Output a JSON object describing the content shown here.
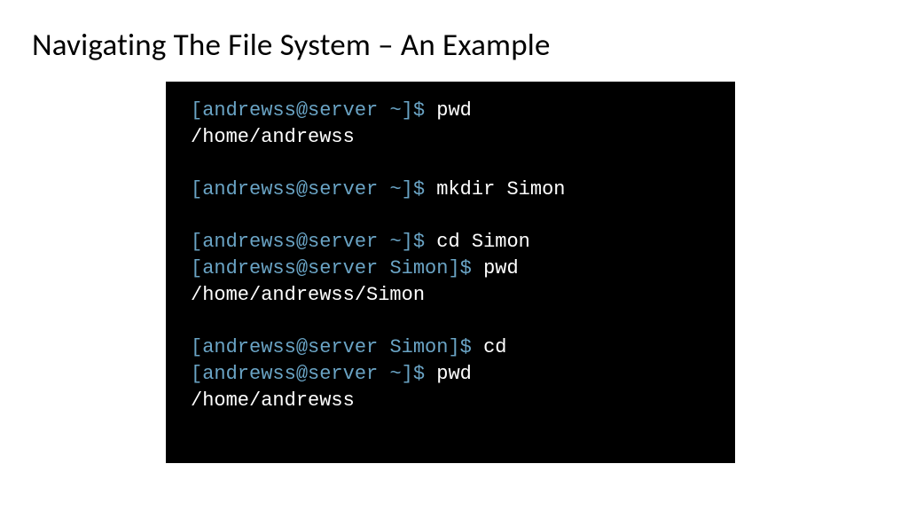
{
  "title": "Navigating The File System – An Example",
  "colors": {
    "terminal_bg": "#000000",
    "prompt_color": "#6aa4c5",
    "cmd_color": "#ffffff",
    "output_color": "#ffffff"
  },
  "prompt": {
    "open_bracket": "[",
    "user": "andrewss",
    "at": "@",
    "host": "server",
    "close_bracket": "]",
    "dollar": "$"
  },
  "lines": [
    {
      "type": "cmd",
      "path": "~",
      "command": "pwd"
    },
    {
      "type": "out",
      "text": "/home/andrewss"
    },
    {
      "type": "blank"
    },
    {
      "type": "cmd",
      "path": "~",
      "command": "mkdir Simon"
    },
    {
      "type": "blank"
    },
    {
      "type": "cmd",
      "path": "~",
      "command": "cd Simon"
    },
    {
      "type": "cmd",
      "path": "Simon",
      "command": "pwd"
    },
    {
      "type": "out",
      "text": "/home/andrewss/Simon"
    },
    {
      "type": "blank"
    },
    {
      "type": "cmd",
      "path": "Simon",
      "command": "cd"
    },
    {
      "type": "cmd",
      "path": "~",
      "command": "pwd"
    },
    {
      "type": "out",
      "text": "/home/andrewss"
    }
  ]
}
